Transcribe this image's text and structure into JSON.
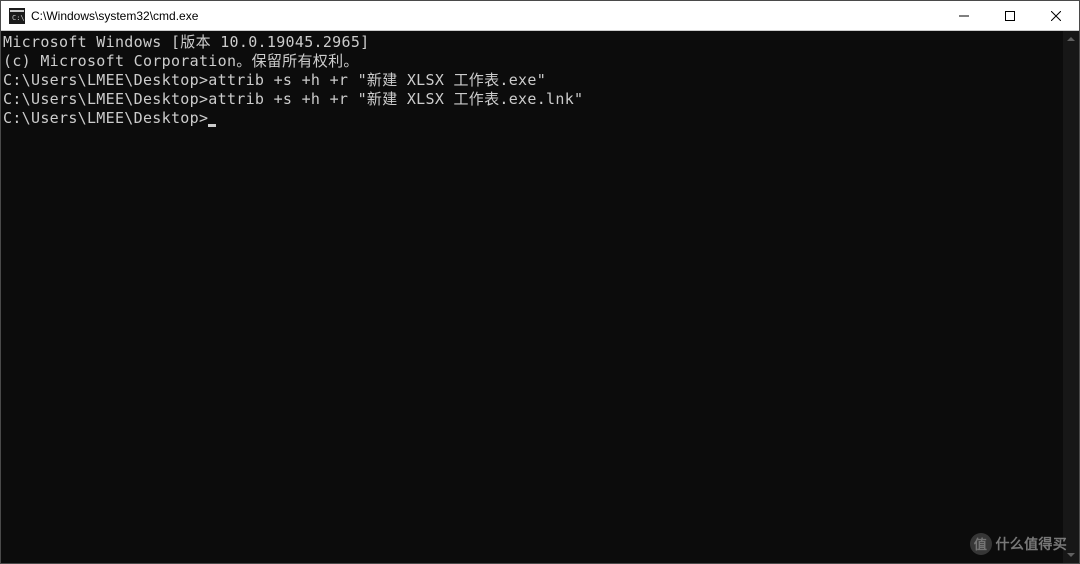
{
  "window": {
    "title": "C:\\Windows\\system32\\cmd.exe"
  },
  "terminal": {
    "lines": [
      "Microsoft Windows [版本 10.0.19045.2965]",
      "(c) Microsoft Corporation。保留所有权利。",
      "",
      "C:\\Users\\LMEE\\Desktop>attrib +s +h +r \"新建 XLSX 工作表.exe\"",
      "",
      "C:\\Users\\LMEE\\Desktop>attrib +s +h +r \"新建 XLSX 工作表.exe.lnk\"",
      "",
      "C:\\Users\\LMEE\\Desktop>"
    ],
    "prompt_path": "C:\\Users\\LMEE\\Desktop>",
    "cursor_visible": true
  },
  "watermark": {
    "badge": "值",
    "text": "什么值得买"
  }
}
